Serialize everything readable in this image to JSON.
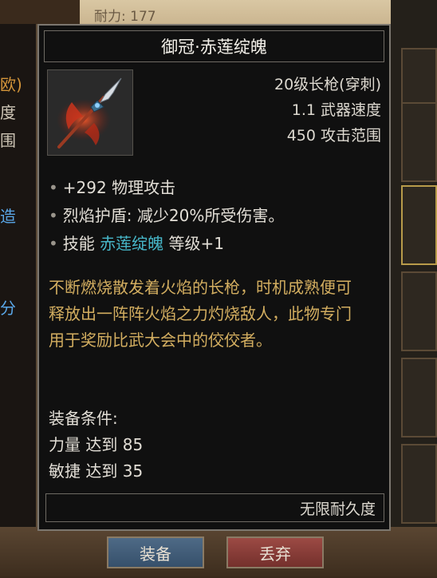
{
  "background": {
    "durability_text": "耐力: 177",
    "left_panel_fragments": [
      "欧)",
      "度",
      "围",
      "造",
      "分",
      "度"
    ]
  },
  "tooltip": {
    "title": "御冠·赤莲绽魄",
    "item_icon": "spear-icon",
    "stats": [
      "20级长枪(穿刺)",
      "1.1 武器速度",
      "450 攻击范围"
    ],
    "effects": {
      "physical_attack": "+292 物理攻击",
      "flame_shield": "烈焰护盾: 减少20%所受伤害。",
      "skill_prefix": "技能",
      "skill_name": "赤莲绽魄",
      "skill_suffix": "等级+1"
    },
    "lore": "不断燃烧散发着火焰的长枪，时机成熟便可释放出一阵阵火焰之力灼烧敌人，此物专门用于奖励比武大会中的佼佼者。",
    "requirements": {
      "header": "装备条件:",
      "strength": "力量 达到 85",
      "agility": "敏捷 达到 35"
    },
    "durability": "无限耐久度"
  },
  "buttons": {
    "equip": "装备",
    "drop": "丢弃"
  },
  "colors": {
    "skill_name": "#47b7c9",
    "lore_text": "#d3ae60",
    "equip_button": "#4e6a86",
    "drop_button": "#9c4a44"
  }
}
